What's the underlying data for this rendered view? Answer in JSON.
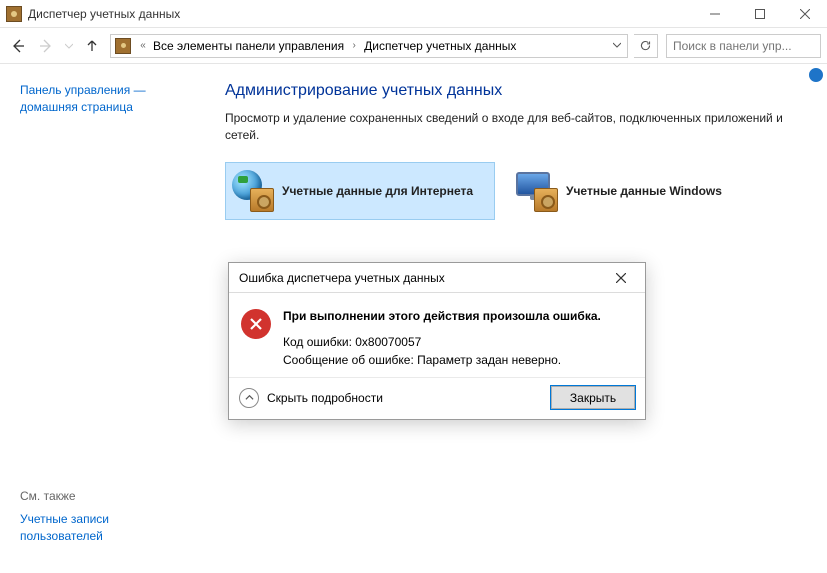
{
  "window": {
    "title": "Диспетчер учетных данных"
  },
  "nav": {
    "crumbs": [
      "Все элементы панели управления",
      "Диспетчер учетных данных"
    ]
  },
  "search": {
    "placeholder": "Поиск в панели упр..."
  },
  "sidebar": {
    "home_link": "Панель управления — домашняя страница",
    "see_also_title": "См. также",
    "see_also_link": "Учетные записи пользователей"
  },
  "main": {
    "heading": "Администрирование учетных данных",
    "subtext": "Просмотр и удаление сохраненных сведений о входе для веб-сайтов, подключенных приложений и сетей.",
    "tile_web": "Учетные данные для Интернета",
    "tile_win": "Учетные данные Windows"
  },
  "dialog": {
    "title": "Ошибка диспетчера учетных данных",
    "message": "При выполнении этого действия произошла ошибка.",
    "code_label": "Код ошибки: 0x80070057",
    "detail_label": "Сообщение об ошибке: Параметр задан неверно.",
    "toggle": "Скрыть подробности",
    "close": "Закрыть"
  }
}
